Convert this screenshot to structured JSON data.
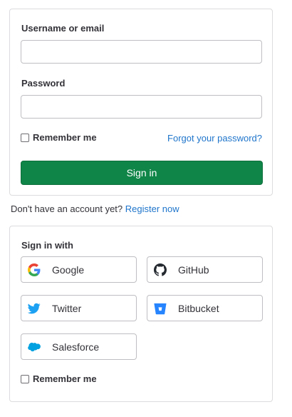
{
  "login": {
    "username_label": "Username or email",
    "username_value": "",
    "password_label": "Password",
    "password_value": "",
    "remember_label": "Remember me",
    "forgot_link": "Forgot your password?",
    "signin_button": "Sign in"
  },
  "register": {
    "prompt": "Don't have an account yet?",
    "link": "Register now"
  },
  "oauth": {
    "title": "Sign in with",
    "providers": [
      {
        "label": "Google",
        "icon": "google-icon"
      },
      {
        "label": "GitHub",
        "icon": "github-icon"
      },
      {
        "label": "Twitter",
        "icon": "twitter-icon"
      },
      {
        "label": "Bitbucket",
        "icon": "bitbucket-icon"
      },
      {
        "label": "Salesforce",
        "icon": "salesforce-icon"
      }
    ],
    "remember_label": "Remember me"
  },
  "colors": {
    "primary_green": "#108548",
    "link_blue": "#1f75cb",
    "border": "#dcdcde"
  }
}
